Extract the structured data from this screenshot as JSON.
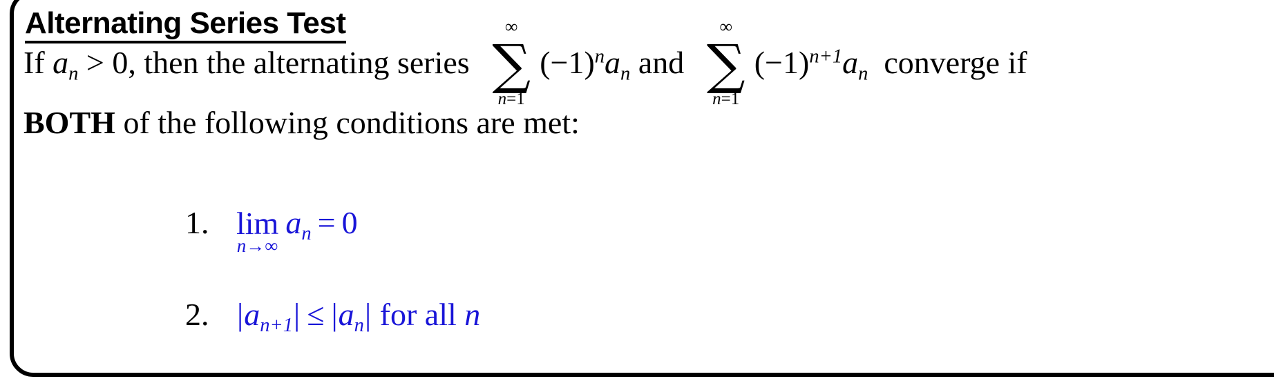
{
  "theorem": {
    "title": "Alternating Series Test",
    "statement": {
      "lead": "If",
      "var_a": "a",
      "var_a_sub": "n",
      "gt_zero": "> 0,",
      "middle": "then the alternating series",
      "conjunction": "and",
      "tail": "converge if",
      "sum1": {
        "upper": "∞",
        "lower_var": "n",
        "lower_eq": "=1",
        "sigma": "∑",
        "base_open": "(−1)",
        "exponent": "n",
        "term": "a",
        "term_sub": "n"
      },
      "sum2": {
        "upper": "∞",
        "lower_var": "n",
        "lower_eq": "=1",
        "sigma": "∑",
        "base_open": "(−1)",
        "exponent": "n+1",
        "term": "a",
        "term_sub": "n"
      }
    },
    "requirement": {
      "emphasis": "BOTH",
      "rest": "of the following conditions are met:"
    },
    "conditions": [
      {
        "number": "1.",
        "operator": "lim",
        "operator_sub_var": "n",
        "operator_sub_arrow": "→∞",
        "var": "a",
        "var_sub": "n",
        "relation": "=",
        "value": "0"
      },
      {
        "number": "2.",
        "lhs_bar_open": "|",
        "lhs_var": "a",
        "lhs_sub": "n+1",
        "lhs_bar_close": "|",
        "relation": "≤",
        "rhs_bar_open": "|",
        "rhs_var": "a",
        "rhs_sub": "n",
        "rhs_bar_close": "|",
        "qualifier": "for all",
        "qualifier_var": "n"
      }
    ]
  },
  "colors": {
    "math_blue": "#1915D8",
    "text_black": "#000000",
    "border_black": "#000000",
    "background": "#FFFFFF"
  }
}
